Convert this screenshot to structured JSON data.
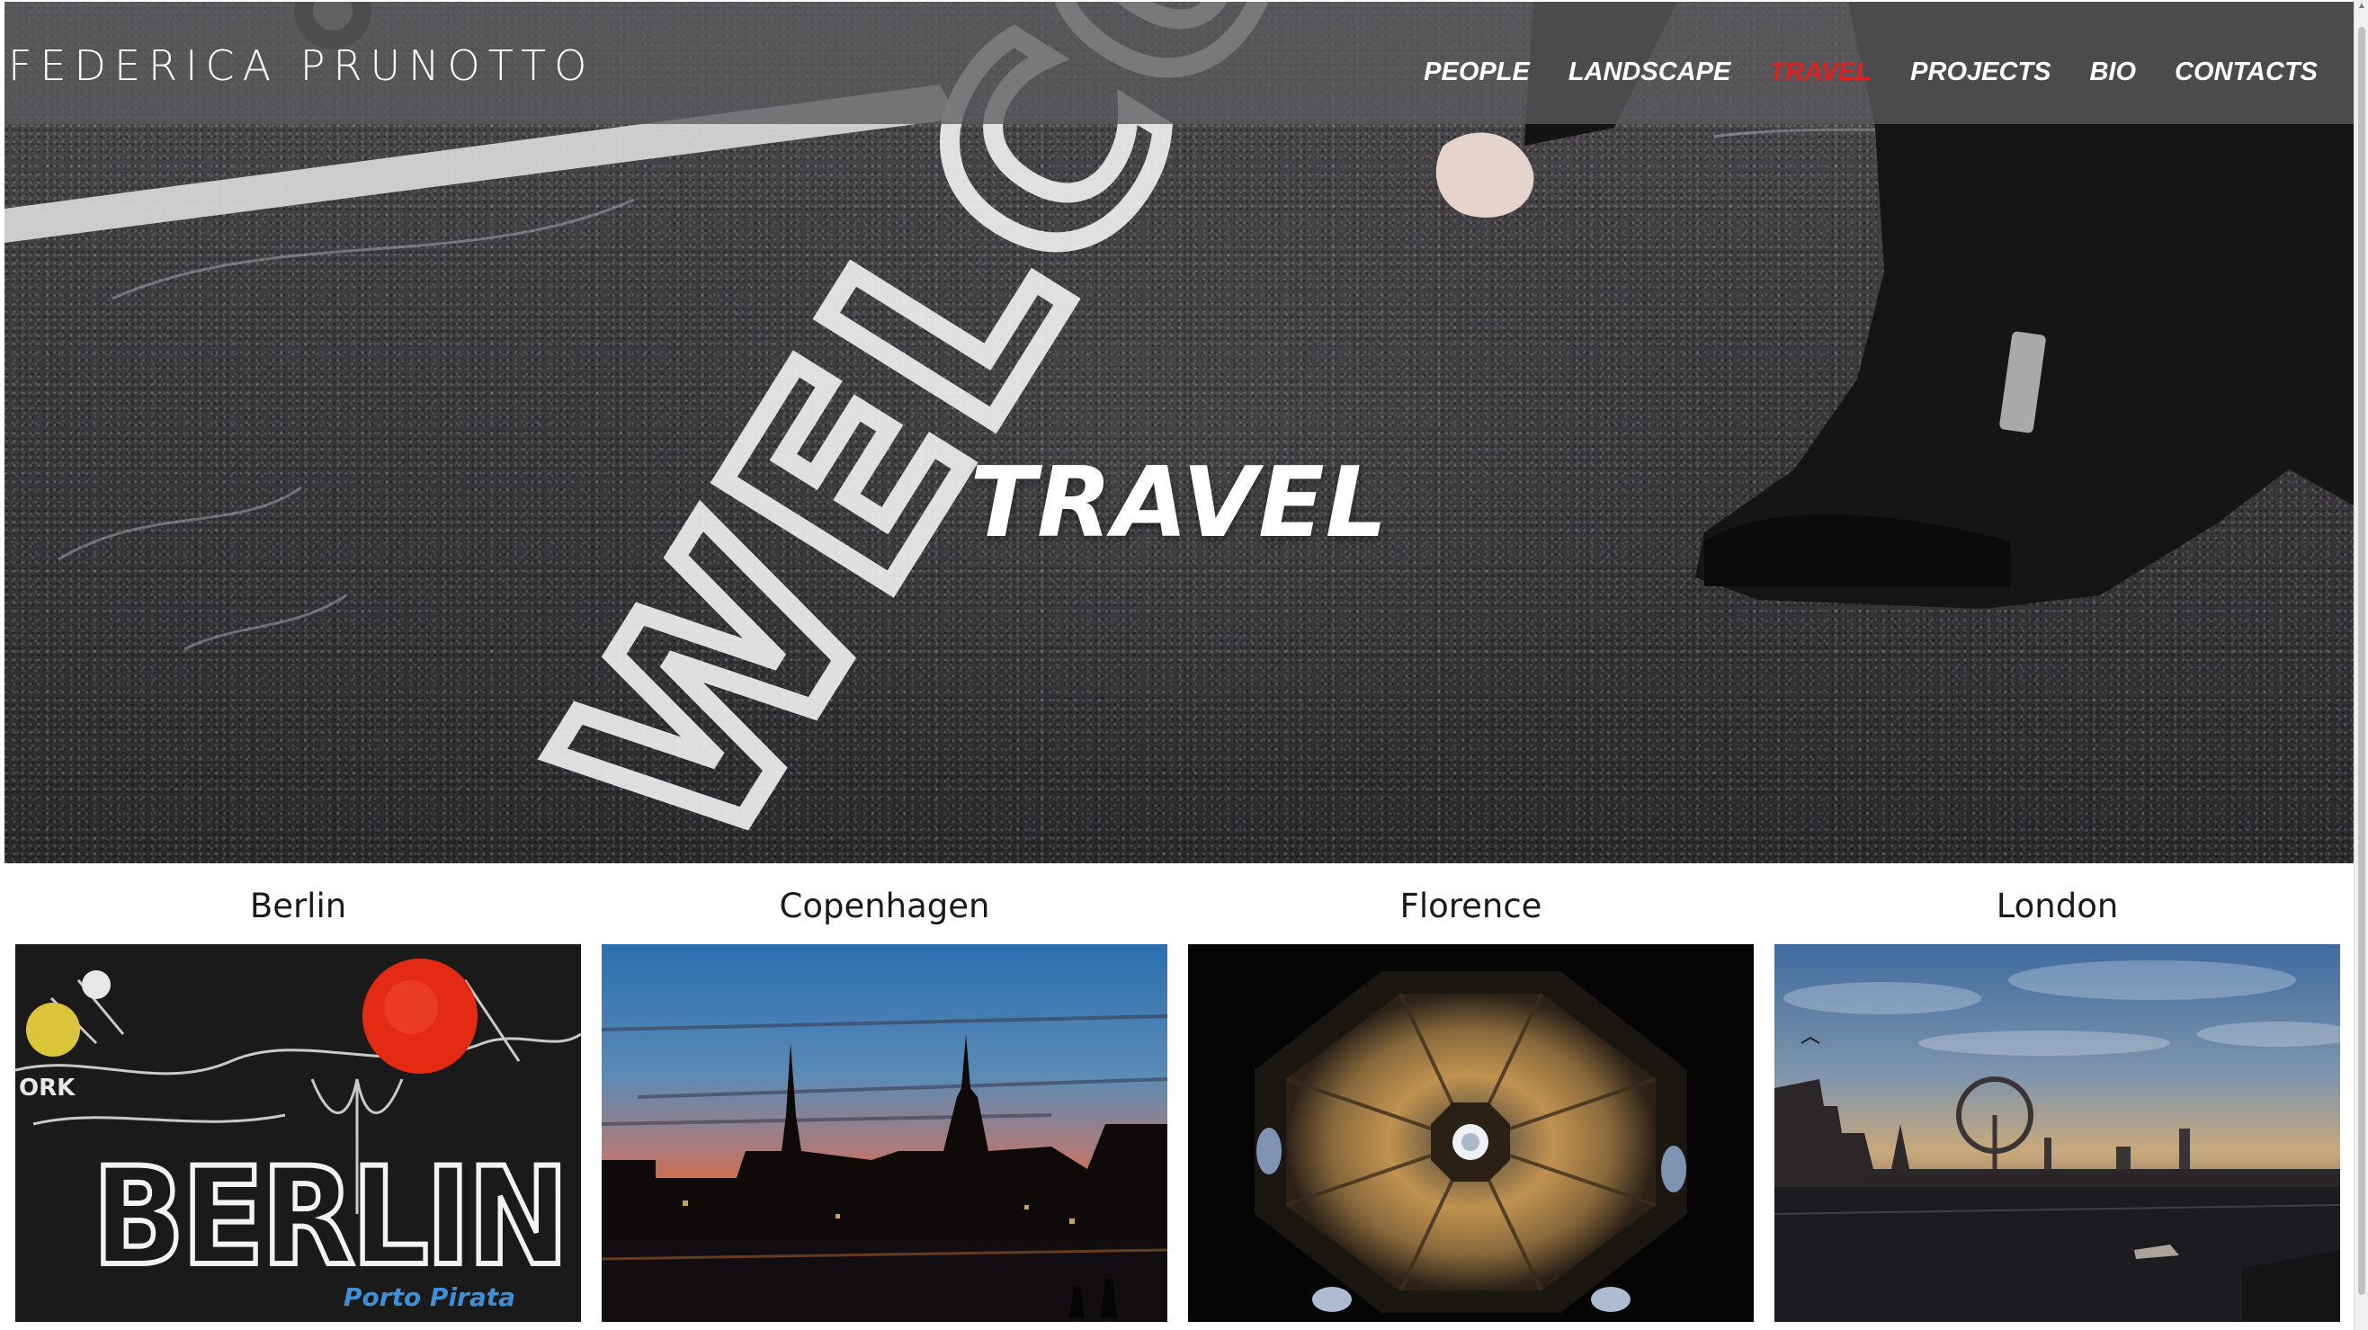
{
  "site": {
    "logo_text": "FEDERICA PRUNOTTO"
  },
  "nav": {
    "items": [
      {
        "label": "PEOPLE",
        "active": false
      },
      {
        "label": "LANDSCAPE",
        "active": false
      },
      {
        "label": "TRAVEL",
        "active": true
      },
      {
        "label": "PROJECTS",
        "active": false
      },
      {
        "label": "BIO",
        "active": false
      },
      {
        "label": "CONTACTS",
        "active": false
      }
    ],
    "active_color": "#e0201e"
  },
  "hero": {
    "title": "TRAVEL",
    "chalk_text": "WELCOME"
  },
  "gallery": {
    "items": [
      {
        "title": "Berlin",
        "image": "berlin-wall-graffiti",
        "image_text": "BERLIN",
        "image_subtext": "Porto Pirata",
        "image_corner_text": "ORK"
      },
      {
        "title": "Copenhagen",
        "image": "copenhagen-sunset-skyline"
      },
      {
        "title": "Florence",
        "image": "florence-duomo-dome"
      },
      {
        "title": "London",
        "image": "london-thames-skyline"
      }
    ]
  },
  "scrollbar": {
    "up_arrow_icon": "chevron-up-icon"
  }
}
